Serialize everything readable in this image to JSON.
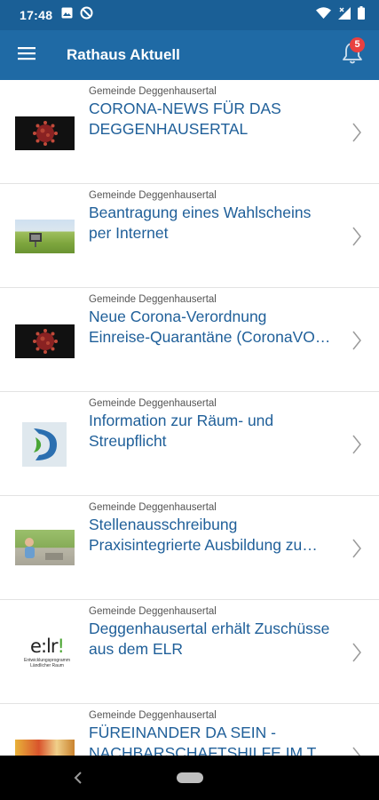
{
  "status_bar": {
    "time": "17:48",
    "left_icons": [
      "image-icon",
      "no-sync-icon"
    ],
    "right_icons": [
      "wifi-icon",
      "signal-icon",
      "battery-icon"
    ]
  },
  "app_bar": {
    "title": "Rathaus Aktuell",
    "menu_icon": "hamburger-menu-icon",
    "notifications_icon": "bell-icon",
    "notification_count": "5",
    "background_color": "#1f6aa5",
    "badge_color": "#e84040"
  },
  "news": [
    {
      "source": "Gemeinde Deggenhausertal",
      "title_lines": [
        "CORONA-NEWS FÜR DAS",
        "DEGGENHAUSERTAL"
      ],
      "thumbnail": "coronavirus-image"
    },
    {
      "source": "Gemeinde Deggenhausertal",
      "title_lines": [
        "Beantragung eines Wahlscheins",
        "per Internet"
      ],
      "thumbnail": "field-landscape-image"
    },
    {
      "source": "Gemeinde Deggenhausertal",
      "title_lines": [
        "Neue Corona-Verordnung",
        "Einreise-Quarantäne (CoronaVO…"
      ],
      "thumbnail": "coronavirus-image"
    },
    {
      "source": "Gemeinde Deggenhausertal",
      "title_lines": [
        "Information zur Räum- und",
        "Streupflicht"
      ],
      "thumbnail": "municipality-logo-image"
    },
    {
      "source": "Gemeinde Deggenhausertal",
      "title_lines": [
        "Stellenausschreibung",
        "Praxisintegrierte Ausbildung zu…"
      ],
      "thumbnail": "child-outdoors-image"
    },
    {
      "source": "Gemeinde Deggenhausertal",
      "title_lines": [
        "Deggenhausertal erhält Zuschüsse",
        "aus dem ELR"
      ],
      "thumbnail": "elr-logo-image",
      "thumbnail_text": {
        "mark_prefix": "e:lr",
        "mark_suffix": "!",
        "subtitle": "Entwicklungsprogramm Ländlicher Raum"
      }
    },
    {
      "source": "Gemeinde Deggenhausertal",
      "title_lines": [
        "FÜREINANDER DA SEIN -",
        "NACHBARSCHAFTSHILFE IM T…"
      ],
      "thumbnail": "food-image"
    }
  ],
  "nav_bar": {
    "back_icon": "back-triangle-icon",
    "home_icon": "home-pill-icon"
  }
}
